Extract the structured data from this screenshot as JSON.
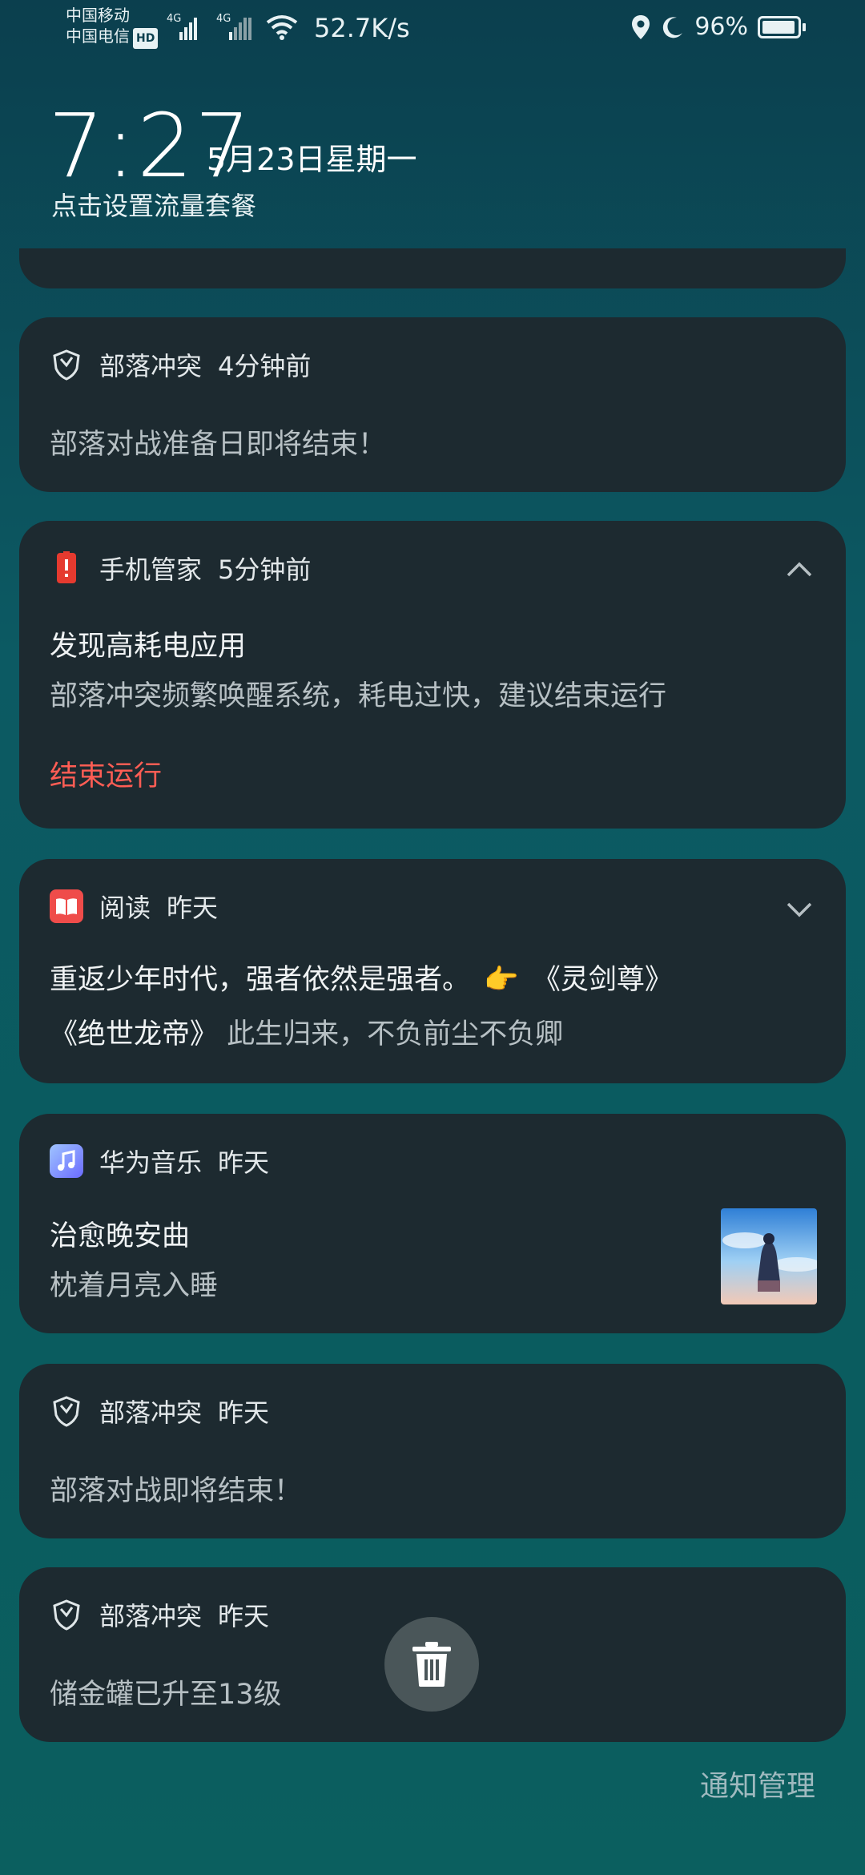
{
  "status_bar": {
    "carrier_1": "中国移动",
    "carrier_2": "中国电信",
    "hd_badge": "HD",
    "network_1": "4G",
    "network_2": "4G",
    "net_speed": "52.7K/s",
    "battery_percent": "96%",
    "battery_level": 0.96
  },
  "lockscreen": {
    "time": "7:27",
    "date": "5月23日星期一",
    "data_plan_link": "点击设置流量套餐"
  },
  "notifications": [
    {
      "app": "部落冲突",
      "time": "4分钟前",
      "title": "",
      "body": "部落对战准备日即将结束！",
      "icon": "clash-shield-icon"
    },
    {
      "app": "手机管家",
      "time": "5分钟前",
      "title": "发现高耗电应用",
      "body": "部落冲突频繁唤醒系统，耗电过快，建议结束运行",
      "action": "结束运行",
      "icon": "phone-manager-battery-icon",
      "expanded": true
    },
    {
      "app": "阅读",
      "time": "昨天",
      "line1": "重返少年时代，强者依然是强者。",
      "emoji": "👉",
      "book_1": "《灵剑尊》",
      "book_2": "《绝世龙帝》",
      "line2_rest": "此生归来，不负前尘不负卿",
      "icon": "book-icon",
      "expanded": false
    },
    {
      "app": "华为音乐",
      "time": "昨天",
      "title": "治愈晚安曲",
      "body": "枕着月亮入睡",
      "icon": "music-note-icon"
    },
    {
      "app": "部落冲突",
      "time": "昨天",
      "body": "部落对战即将结束！",
      "icon": "clash-shield-icon"
    },
    {
      "app": "部落冲突",
      "time": "昨天",
      "body": "储金罐已升至13级",
      "icon": "clash-shield-icon"
    }
  ],
  "footer": {
    "manage_link": "通知管理"
  },
  "colors": {
    "card_bg": "#1d2a30",
    "accent_red": "#ff5d54"
  }
}
